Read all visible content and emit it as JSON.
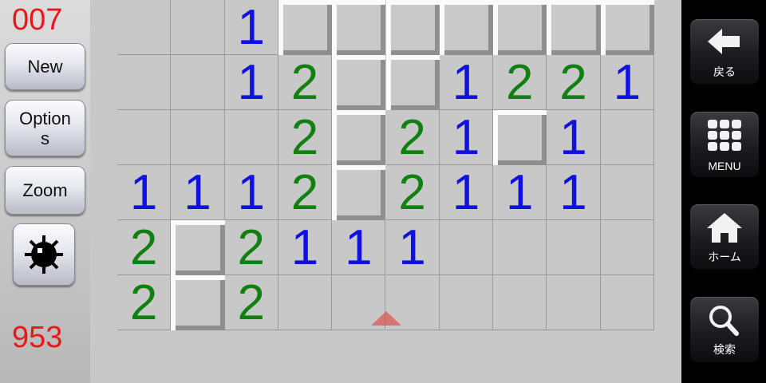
{
  "mine_counter": "007",
  "timer": "953",
  "left_buttons": {
    "new": "New",
    "options": "Option\ns",
    "zoom": "Zoom"
  },
  "board": {
    "rows": [
      [
        "",
        "",
        "1",
        "#",
        "#",
        "#",
        "#",
        "#",
        "#",
        "#"
      ],
      [
        "",
        "",
        "1",
        "2",
        "#",
        "#",
        "1",
        "2",
        "2",
        "1"
      ],
      [
        "",
        "",
        "",
        "2",
        "#",
        "2",
        "1",
        "#",
        "1",
        ""
      ],
      [
        "1",
        "1",
        "1",
        "2",
        "#",
        "2",
        "1",
        "1",
        "1",
        ""
      ],
      [
        "2",
        "#",
        "2",
        "1",
        "1",
        "1",
        "",
        "",
        "",
        ""
      ],
      [
        "2",
        "#",
        "2",
        "",
        "",
        "",
        "",
        "",
        "",
        ""
      ]
    ],
    "number_colors": {
      "1": "#1010e0",
      "2": "#108010"
    }
  },
  "nav": {
    "back": "戻る",
    "menu": "MENU",
    "home": "ホーム",
    "search": "検索"
  }
}
